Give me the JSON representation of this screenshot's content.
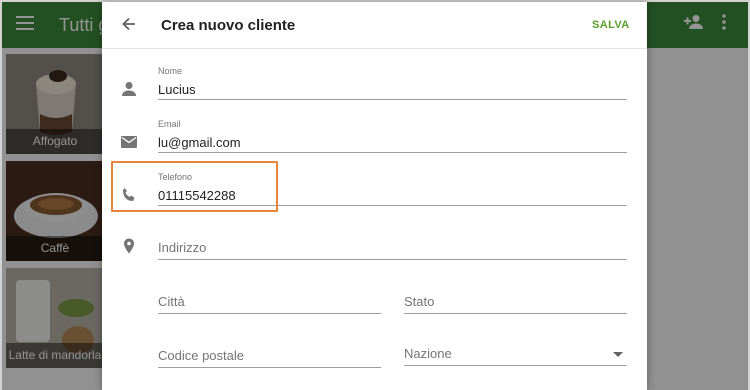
{
  "background": {
    "title": "Tutti gli articoli",
    "icons": {
      "menu": "menu-icon",
      "add_user": "add-user-icon",
      "more": "more-vert-icon"
    },
    "items": [
      {
        "label": "Affogato"
      },
      {
        "label": "Caffè"
      },
      {
        "label": "Latte di mandorla"
      }
    ]
  },
  "dialog": {
    "title": "Crea nuovo cliente",
    "save_label": "SALVA",
    "fields": {
      "name": {
        "label": "Nome",
        "value": "Lucius",
        "icon": "person-icon"
      },
      "email": {
        "label": "Email",
        "value": "lu@gmail.com",
        "icon": "email-icon"
      },
      "phone": {
        "label": "Telefono",
        "value": "01115542288",
        "icon": "phone-icon"
      },
      "address": {
        "placeholder": "Indirizzo",
        "icon": "location-icon"
      },
      "city": {
        "placeholder": "Città"
      },
      "state": {
        "placeholder": "Stato"
      },
      "postal": {
        "placeholder": "Codice postale"
      },
      "country": {
        "placeholder": "Nazione"
      }
    }
  },
  "colors": {
    "accent": "#5aa02c",
    "toolbar": "#3d8b3d",
    "highlight": "#e8843c"
  }
}
